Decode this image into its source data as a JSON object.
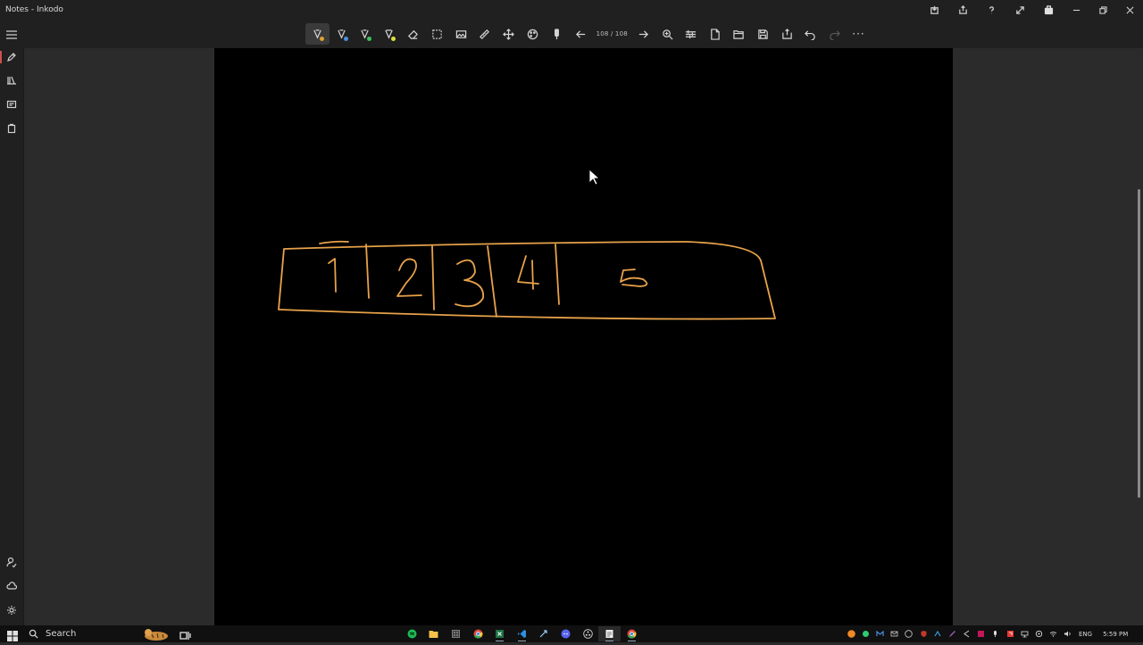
{
  "window": {
    "title": "Notes - Inkodo"
  },
  "title_actions": [
    "save-to-device-icon",
    "share-icon",
    "help-icon",
    "fullscreen-icon",
    "store-icon"
  ],
  "toolbar": {
    "page_counter": "108 / 108",
    "tools": [
      {
        "name": "pen-tool-1",
        "dot": "#e0a030",
        "active": true
      },
      {
        "name": "pen-tool-2",
        "dot": "#4a90e0"
      },
      {
        "name": "pen-tool-3",
        "dot": "#40c060"
      },
      {
        "name": "highlighter-tool",
        "dot": "#e0e040"
      }
    ],
    "more_label": "···"
  },
  "canvas": {
    "stroke_color": "#e8a24a",
    "cells": [
      "1",
      "2",
      "3",
      "4",
      "5"
    ]
  },
  "taskbar": {
    "search_label": "Search",
    "language": "ENG",
    "time": "5:59 PM"
  },
  "colors": {
    "accent_red": "#d05050",
    "tray_orange": "#f08a24"
  }
}
